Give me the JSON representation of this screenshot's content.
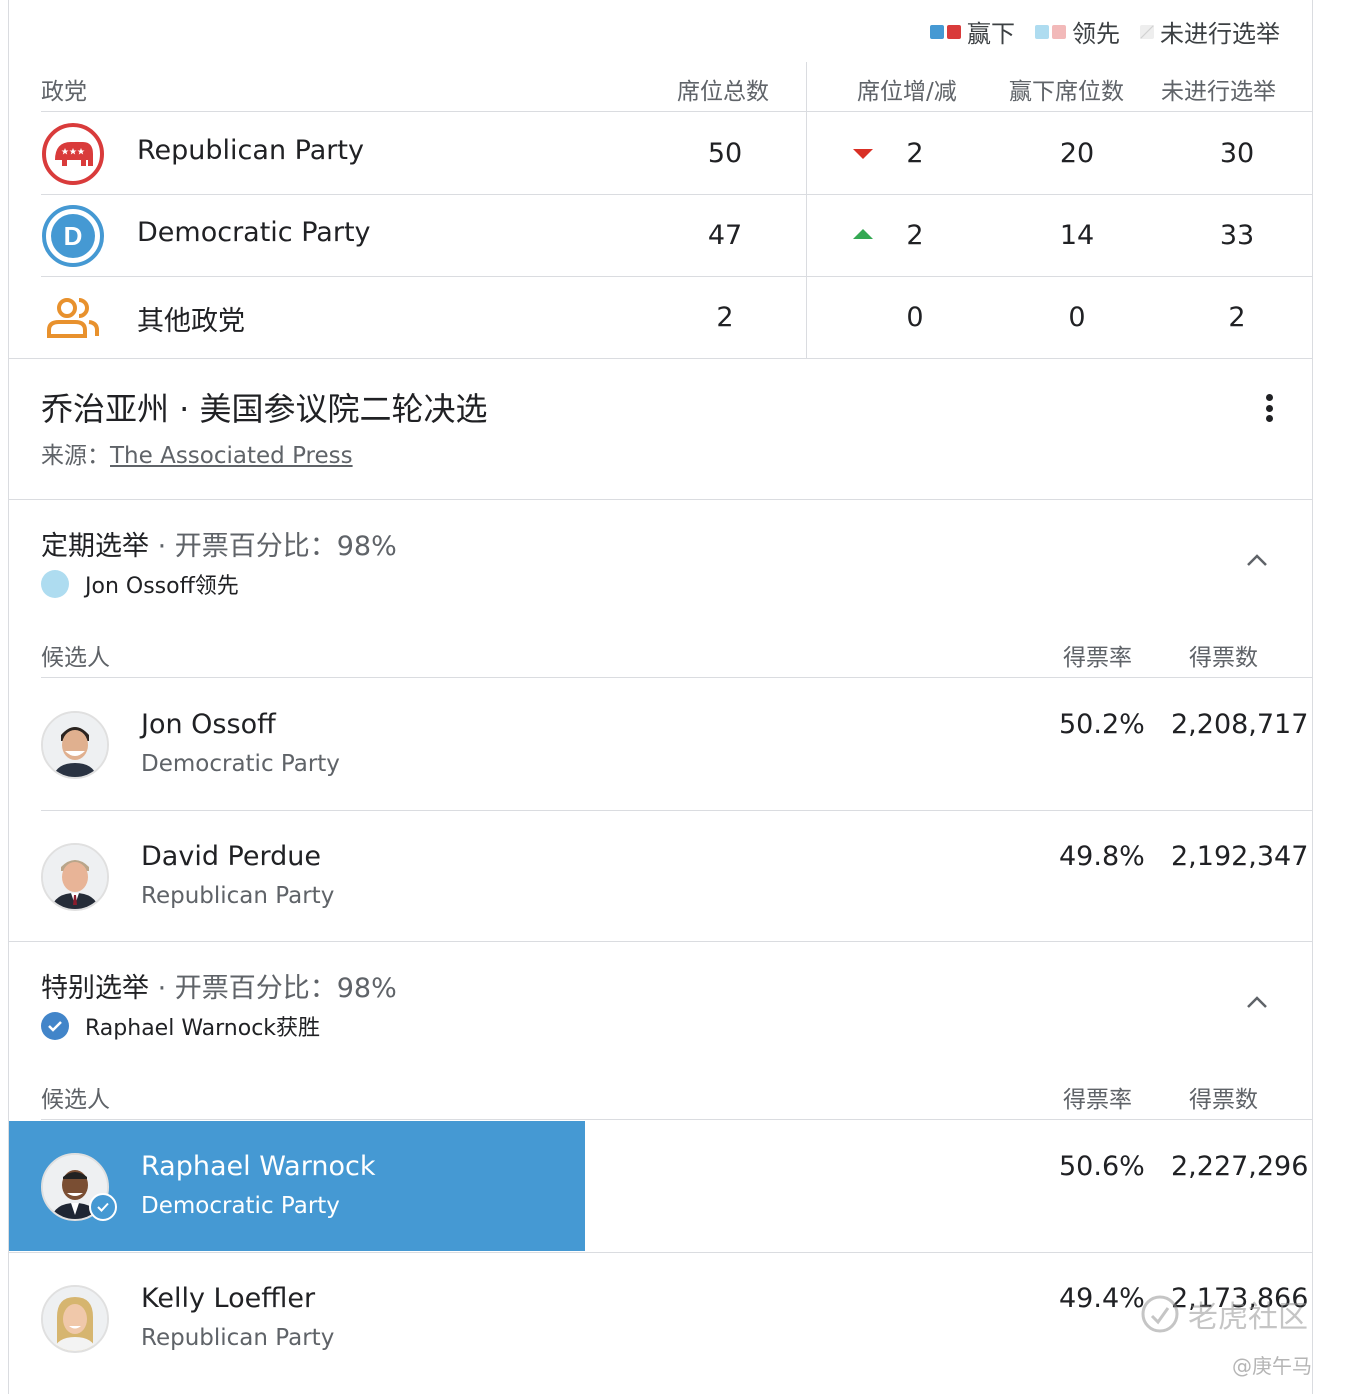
{
  "legend": {
    "won": "赢下",
    "leading": "领先",
    "not_held": "未进行选举"
  },
  "colors": {
    "dem": "#4599d3",
    "rep": "#d93b3b",
    "dem_light": "#aedcf0",
    "rep_light": "#f2b9b9",
    "highlight": "#4599d3"
  },
  "seats": {
    "headers": {
      "party": "政党",
      "total": "席位总数",
      "change": "席位增/减",
      "won": "赢下席位数",
      "not_held": "未进行选举"
    },
    "rows": [
      {
        "name": "Republican Party",
        "icon": "republican-elephant-icon",
        "total": "50",
        "change": "2",
        "trend": "down",
        "won": "20",
        "not_held": "30"
      },
      {
        "name": "Democratic Party",
        "icon": "democratic-d-icon",
        "total": "47",
        "change": "2",
        "trend": "up",
        "won": "14",
        "not_held": "33"
      },
      {
        "name": "其他政党",
        "icon": "people-group-icon",
        "total": "2",
        "change": "0",
        "trend": "none",
        "won": "0",
        "not_held": "2"
      }
    ]
  },
  "race": {
    "title": "乔治亚州 · 美国参议院二轮决选",
    "source_label": "来源：",
    "source_link": "The Associated Press"
  },
  "regular": {
    "title": "定期选举",
    "reporting": " · 开票百分比：98%",
    "status": "Jon Ossoff领先",
    "headers": {
      "candidate": "候选人",
      "pct": "得票率",
      "votes": "得票数"
    },
    "candidates": [
      {
        "name": "Jon Ossoff",
        "party": "Democratic Party",
        "pct": "50.2%",
        "votes": "2,208,717"
      },
      {
        "name": "David Perdue",
        "party": "Republican Party",
        "pct": "49.8%",
        "votes": "2,192,347"
      }
    ]
  },
  "special": {
    "title": "特别选举",
    "reporting": " · 开票百分比：98%",
    "status": "Raphael Warnock获胜",
    "headers": {
      "candidate": "候选人",
      "pct": "得票率",
      "votes": "得票数"
    },
    "candidates": [
      {
        "name": "Raphael Warnock",
        "party": "Democratic Party",
        "pct": "50.6%",
        "votes": "2,227,296",
        "winner": true
      },
      {
        "name": "Kelly Loeffler",
        "party": "Republican Party",
        "pct": "49.4%",
        "votes": "2,173,866"
      }
    ]
  },
  "watermark": {
    "brand": "老虎社区",
    "user": "@庚午马"
  }
}
